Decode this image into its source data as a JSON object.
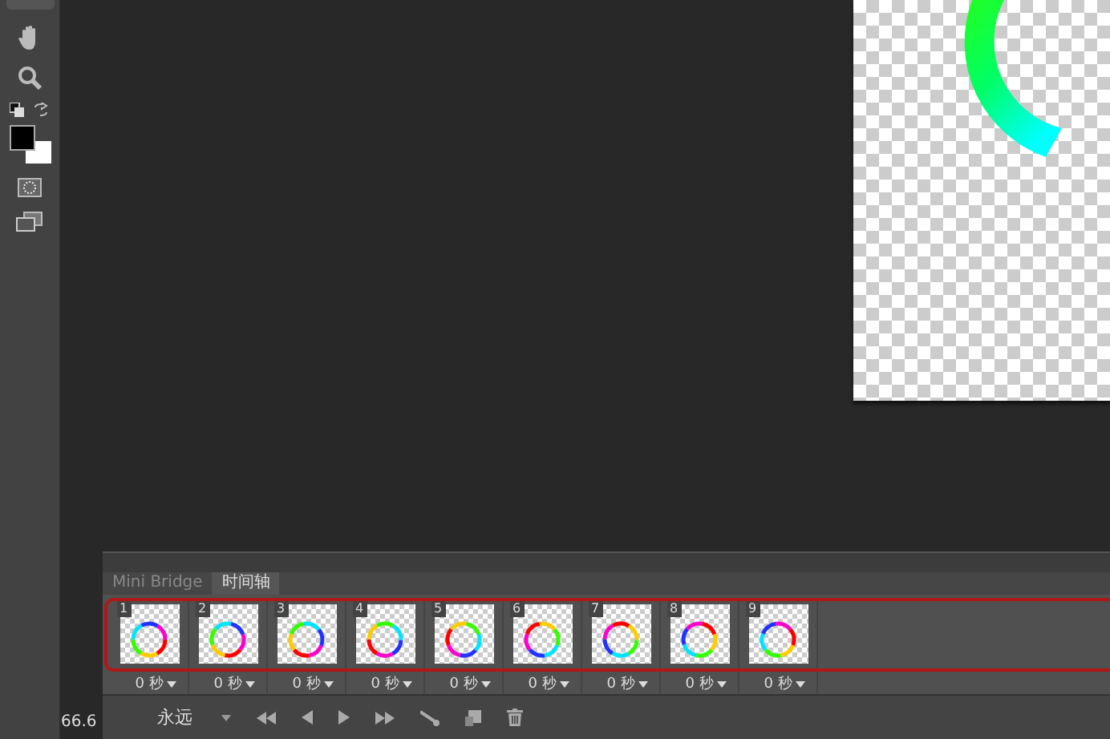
{
  "status_bar": {
    "zoom": "66.6"
  },
  "timeline": {
    "tabs": [
      {
        "label": "Mini Bridge",
        "selected": false
      },
      {
        "label": "时间轴",
        "selected": true
      }
    ],
    "frames": [
      {
        "number": "1",
        "delay": "0 秒"
      },
      {
        "number": "2",
        "delay": "0 秒"
      },
      {
        "number": "3",
        "delay": "0 秒"
      },
      {
        "number": "4",
        "delay": "0 秒"
      },
      {
        "number": "5",
        "delay": "0 秒"
      },
      {
        "number": "6",
        "delay": "0 秒"
      },
      {
        "number": "7",
        "delay": "0 秒"
      },
      {
        "number": "8",
        "delay": "0 秒"
      },
      {
        "number": "9",
        "delay": "0 秒"
      }
    ],
    "loop": "永远"
  }
}
